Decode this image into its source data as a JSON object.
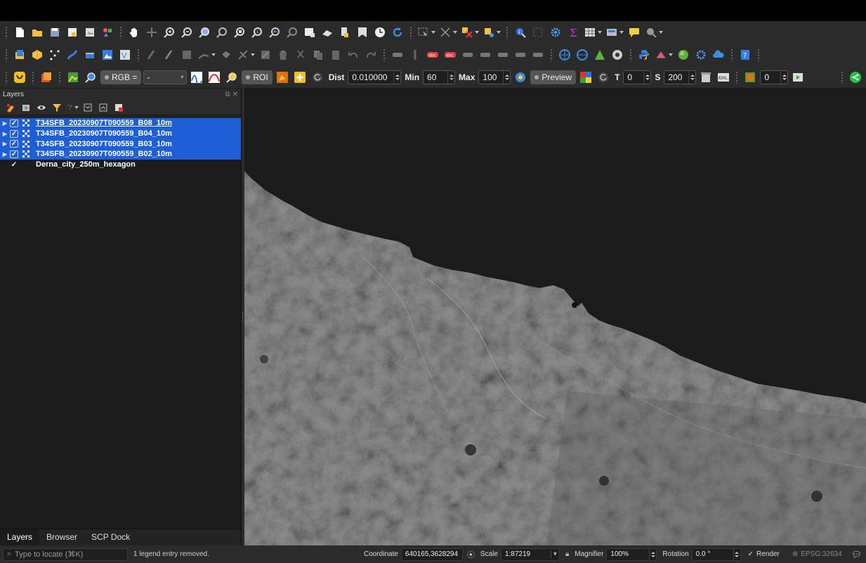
{
  "panel": {
    "title": "Layers",
    "layers": [
      {
        "name": "T34SFB_20230907T090559_B08_10m",
        "checked": true,
        "selected": true
      },
      {
        "name": "T34SFB_20230907T090559_B04_10m",
        "checked": true,
        "selected": true
      },
      {
        "name": "T34SFB_20230907T090559_B03_10m",
        "checked": true,
        "selected": true
      },
      {
        "name": "T34SFB_20230907T090559_B02_10m",
        "checked": true,
        "selected": true
      },
      {
        "name": "Derna_city_250m_hexagon",
        "checked": true,
        "selected": false
      }
    ],
    "tabs": [
      "Layers",
      "Browser",
      "SCP Dock"
    ]
  },
  "scp_toolbar": {
    "rgb_label": "RGB =",
    "rgb_value": "-",
    "roi_label": "ROI",
    "dist_label": "Dist",
    "dist_value": "0.010000",
    "min_label": "Min",
    "min_value": "60",
    "max_label": "Max",
    "max_value": "100",
    "preview_label": "Preview",
    "t_label": "T",
    "t_value": "0",
    "s_label": "S",
    "s_value": "200",
    "band_value": "0"
  },
  "status": {
    "locate_placeholder": "Type to locate (⌘K)",
    "message": "1 legend entry removed.",
    "coordinate_label": "Coordinate",
    "coordinate_value": "640165,3628294",
    "scale_label": "Scale",
    "scale_value": "1:87219",
    "magnifier_label": "Magnifier",
    "magnifier_value": "100%",
    "rotation_label": "Rotation",
    "rotation_value": "0.0 °",
    "render_label": "Render",
    "epsg": "EPSG:32634"
  },
  "colors": {
    "selection": "#1f5fd6",
    "toolbar_bg": "#2b2b2b",
    "panel_bg": "#1c1c1c",
    "sea": "#1b1b1b",
    "land": "#6f6f6f"
  }
}
